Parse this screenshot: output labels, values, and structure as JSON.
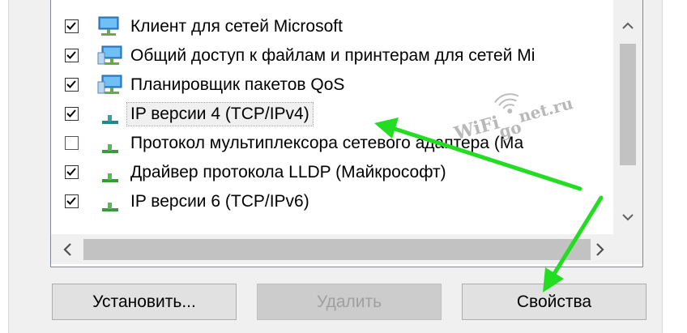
{
  "list": {
    "items": [
      {
        "label": "Клиент для сетей Microsoft",
        "checked": true,
        "icon": "network-client-icon"
      },
      {
        "label": "Общий доступ к файлам и принтерам для сетей Mi",
        "checked": true,
        "icon": "network-service-icon"
      },
      {
        "label": "Планировщик пакетов QoS",
        "checked": true,
        "icon": "network-service-icon"
      },
      {
        "label": "IP версии 4 (TCP/IPv4)",
        "checked": true,
        "icon": "protocol-icon",
        "selected": true
      },
      {
        "label": "Протокол мультиплексора сетевого адаптера (Ма",
        "checked": false,
        "icon": "protocol-icon"
      },
      {
        "label": "Драйвер протокола LLDP (Майкрософт)",
        "checked": true,
        "icon": "protocol-icon"
      },
      {
        "label": "IP версии 6 (TCP/IPv6)",
        "checked": true,
        "icon": "protocol-icon"
      }
    ]
  },
  "buttons": {
    "install": "Установить...",
    "remove": "Удалить",
    "properties": "Свойства"
  },
  "watermark": {
    "text1": "WiFi",
    "text2": "go",
    "text3": "net.ru"
  },
  "colors": {
    "arrow": "#22dd22",
    "selection": "#f0f0f0"
  }
}
